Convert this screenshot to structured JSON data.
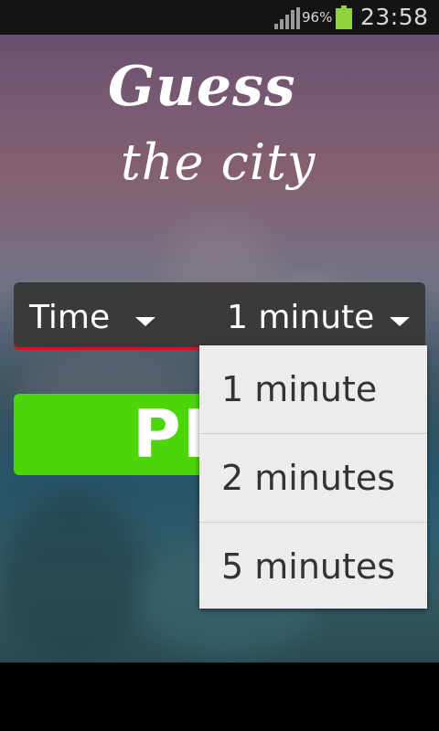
{
  "status_bar": {
    "battery_percent": "96%",
    "time": "23:58"
  },
  "app": {
    "title_line1": "Guess",
    "title_line2": "the city"
  },
  "time_selector": {
    "label": "Time",
    "selected_value": "1 minute"
  },
  "play_button": {
    "label": "PLAY"
  },
  "dropdown": {
    "options": [
      "1 minute",
      "2 minutes",
      "5 minutes"
    ]
  },
  "colors": {
    "play_green": "#4cd60a",
    "selector_bg": "#3a3a3a",
    "selector_underline": "#d01616",
    "dropdown_bg": "#ececec"
  }
}
